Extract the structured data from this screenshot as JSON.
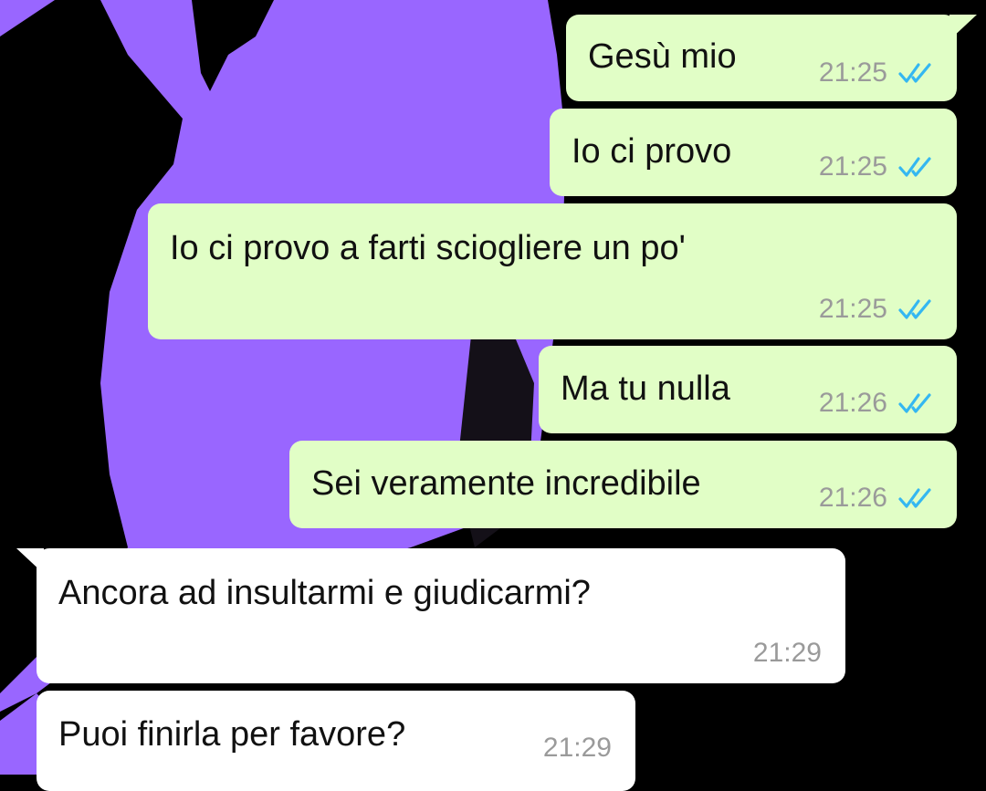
{
  "colors": {
    "outgoing_bubble": "#e1fec6",
    "incoming_bubble": "#ffffff",
    "read_ticks": "#34b7f1",
    "wallpaper_purple": "#9966ff"
  },
  "messages": [
    {
      "direction": "outgoing",
      "text": "Gesù mio",
      "time": "21:25",
      "status_icon": "double-check-read-icon"
    },
    {
      "direction": "outgoing",
      "text": "Io ci provo",
      "time": "21:25",
      "status_icon": "double-check-read-icon"
    },
    {
      "direction": "outgoing",
      "text": "Io ci provo a farti sciogliere un po'",
      "time": "21:25",
      "status_icon": "double-check-read-icon"
    },
    {
      "direction": "outgoing",
      "text": "Ma tu nulla",
      "time": "21:26",
      "status_icon": "double-check-read-icon"
    },
    {
      "direction": "outgoing",
      "text": "Sei veramente incredibile",
      "time": "21:26",
      "status_icon": "double-check-read-icon"
    },
    {
      "direction": "incoming",
      "text": "Ancora ad insultarmi e giudicarmi?",
      "time": "21:29"
    },
    {
      "direction": "incoming",
      "text": "Puoi finirla per favore?",
      "time": "21:29"
    }
  ]
}
